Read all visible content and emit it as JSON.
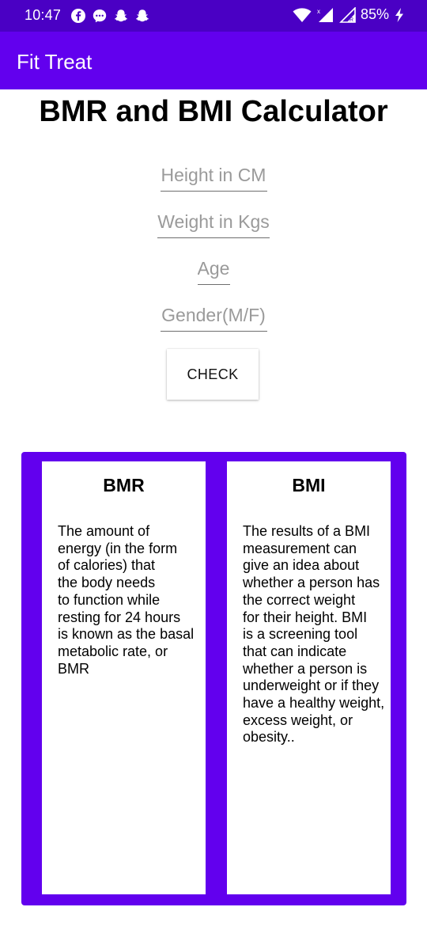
{
  "status_bar": {
    "time": "10:47",
    "battery": "85%",
    "left_icons": [
      "facebook-icon",
      "messenger-icon",
      "snapchat-icon",
      "snapchat-icon"
    ],
    "right_icons": [
      "wifi-icon",
      "signal-icon",
      "signal-r-icon",
      "charging-icon"
    ]
  },
  "app_bar": {
    "title": "Fit Treat",
    "color": "#6200ee"
  },
  "page": {
    "title": "BMR and BMI Calculator"
  },
  "form": {
    "height": {
      "placeholder": "Height in CM",
      "value": ""
    },
    "weight": {
      "placeholder": "Weight in Kgs",
      "value": ""
    },
    "age": {
      "placeholder": "Age",
      "value": ""
    },
    "gender": {
      "placeholder": "Gender(M/F)",
      "value": ""
    },
    "check_label": "CHECK"
  },
  "cards": {
    "bmr": {
      "title": "BMR",
      "lines": [
        "The amount of",
        "energy (in the form",
        "of calories) that",
        "the body needs",
        "to function while",
        "resting for 24 hours",
        "is known as the basal",
        "metabolic rate, or",
        "BMR"
      ]
    },
    "bmi": {
      "title": "BMI",
      "lines": [
        "The results of a BMI",
        "measurement can",
        "give an idea about",
        "whether a person has",
        "the correct weight",
        "for their height. BMI",
        "is a screening tool",
        "that can indicate",
        "whether a person is",
        "underweight or if they",
        "have a healthy weight,",
        "excess weight, or",
        "obesity.."
      ]
    }
  },
  "colors": {
    "primary": "#6200ee",
    "status_bar": "#4a00c4",
    "panel": "#6200ee"
  }
}
